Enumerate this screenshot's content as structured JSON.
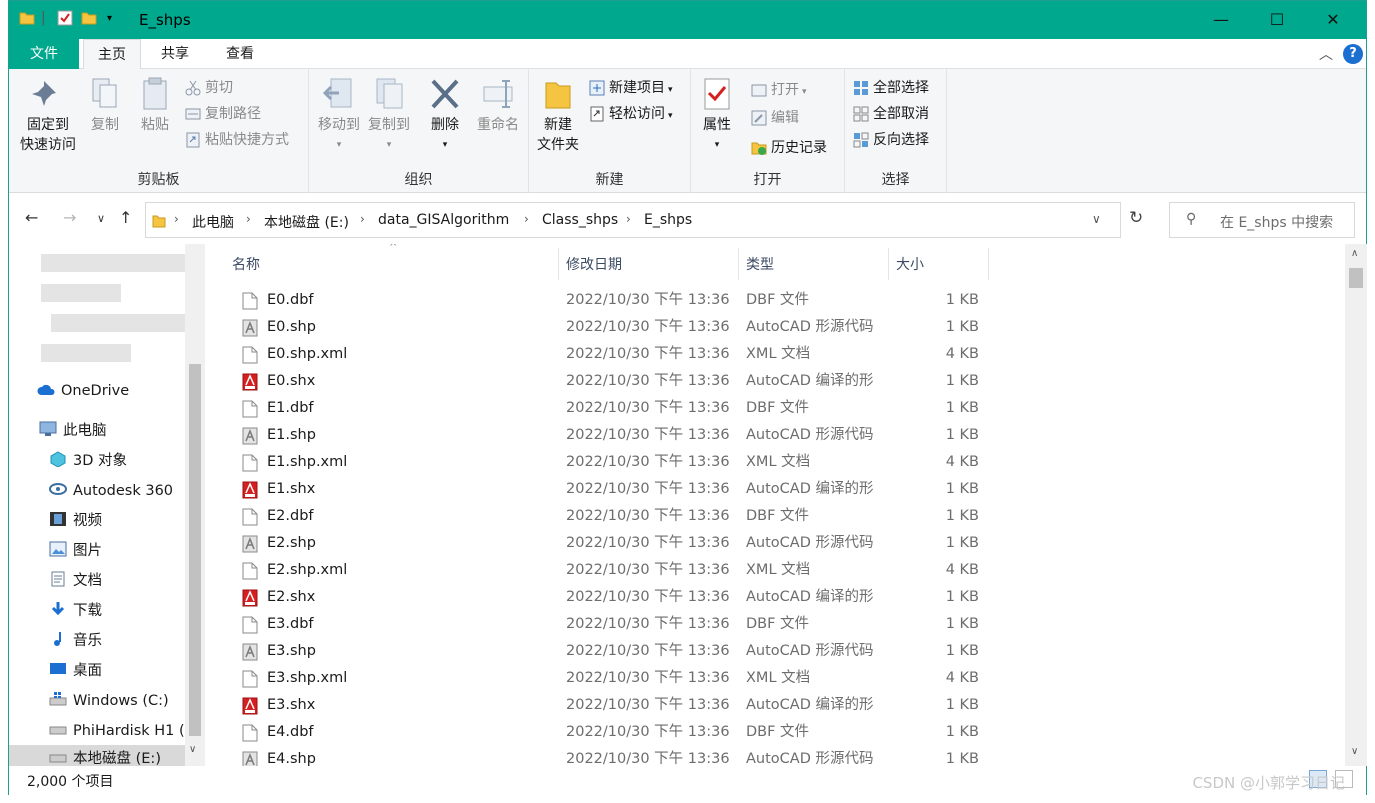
{
  "titlebar": {
    "title": "E_shps",
    "minimize": "—",
    "maximize": "☐",
    "close": "✕"
  },
  "ribbon_tabs": {
    "file": "文件",
    "home": "主页",
    "share": "共享",
    "view": "查看"
  },
  "clipboard": {
    "group_label": "剪贴板",
    "pin_line1": "固定到",
    "pin_line2": "快速访问",
    "copy": "复制",
    "paste": "粘贴",
    "cut": "剪切",
    "copy_path": "复制路径",
    "paste_shortcut": "粘贴快捷方式"
  },
  "organize": {
    "group_label": "组织",
    "move_to": "移动到",
    "copy_to": "复制到",
    "delete": "删除",
    "rename": "重命名"
  },
  "new": {
    "group_label": "新建",
    "new_folder_line1": "新建",
    "new_folder_line2": "文件夹",
    "new_item": "新建项目",
    "easy_access": "轻松访问"
  },
  "open": {
    "group_label": "打开",
    "properties": "属性",
    "open": "打开",
    "edit": "编辑",
    "history": "历史记录"
  },
  "select": {
    "group_label": "选择",
    "select_all": "全部选择",
    "select_none": "全部取消",
    "invert": "反向选择"
  },
  "breadcrumb": [
    "此电脑",
    "本地磁盘 (E:)",
    "data_GISAlgorithm",
    "Class_shps",
    "E_shps"
  ],
  "search": {
    "placeholder": "在 E_shps 中搜索"
  },
  "nav": {
    "onedrive": "OneDrive",
    "this_pc": "此电脑",
    "items": [
      "3D 对象",
      "Autodesk 360",
      "视频",
      "图片",
      "文档",
      "下载",
      "音乐",
      "桌面",
      "Windows (C:)",
      "PhiHardisk H1 (",
      "本地磁盘 (E:)"
    ]
  },
  "columns": {
    "name": "名称",
    "date": "修改日期",
    "type": "类型",
    "size": "大小"
  },
  "files": [
    {
      "name": "E0.dbf",
      "date": "2022/10/30 下午 13:36",
      "type": "DBF 文件",
      "size": "1 KB",
      "icon": "doc"
    },
    {
      "name": "E0.shp",
      "date": "2022/10/30 下午 13:36",
      "type": "AutoCAD 形源代码",
      "size": "1 KB",
      "icon": "shp"
    },
    {
      "name": "E0.shp.xml",
      "date": "2022/10/30 下午 13:36",
      "type": "XML 文档",
      "size": "4 KB",
      "icon": "doc"
    },
    {
      "name": "E0.shx",
      "date": "2022/10/30 下午 13:36",
      "type": "AutoCAD 编译的形",
      "size": "1 KB",
      "icon": "shx"
    },
    {
      "name": "E1.dbf",
      "date": "2022/10/30 下午 13:36",
      "type": "DBF 文件",
      "size": "1 KB",
      "icon": "doc"
    },
    {
      "name": "E1.shp",
      "date": "2022/10/30 下午 13:36",
      "type": "AutoCAD 形源代码",
      "size": "1 KB",
      "icon": "shp"
    },
    {
      "name": "E1.shp.xml",
      "date": "2022/10/30 下午 13:36",
      "type": "XML 文档",
      "size": "4 KB",
      "icon": "doc"
    },
    {
      "name": "E1.shx",
      "date": "2022/10/30 下午 13:36",
      "type": "AutoCAD 编译的形",
      "size": "1 KB",
      "icon": "shx"
    },
    {
      "name": "E2.dbf",
      "date": "2022/10/30 下午 13:36",
      "type": "DBF 文件",
      "size": "1 KB",
      "icon": "doc"
    },
    {
      "name": "E2.shp",
      "date": "2022/10/30 下午 13:36",
      "type": "AutoCAD 形源代码",
      "size": "1 KB",
      "icon": "shp"
    },
    {
      "name": "E2.shp.xml",
      "date": "2022/10/30 下午 13:36",
      "type": "XML 文档",
      "size": "4 KB",
      "icon": "doc"
    },
    {
      "name": "E2.shx",
      "date": "2022/10/30 下午 13:36",
      "type": "AutoCAD 编译的形",
      "size": "1 KB",
      "icon": "shx"
    },
    {
      "name": "E3.dbf",
      "date": "2022/10/30 下午 13:36",
      "type": "DBF 文件",
      "size": "1 KB",
      "icon": "doc"
    },
    {
      "name": "E3.shp",
      "date": "2022/10/30 下午 13:36",
      "type": "AutoCAD 形源代码",
      "size": "1 KB",
      "icon": "shp"
    },
    {
      "name": "E3.shp.xml",
      "date": "2022/10/30 下午 13:36",
      "type": "XML 文档",
      "size": "4 KB",
      "icon": "doc"
    },
    {
      "name": "E3.shx",
      "date": "2022/10/30 下午 13:36",
      "type": "AutoCAD 编译的形",
      "size": "1 KB",
      "icon": "shx"
    },
    {
      "name": "E4.dbf",
      "date": "2022/10/30 下午 13:36",
      "type": "DBF 文件",
      "size": "1 KB",
      "icon": "doc"
    },
    {
      "name": "E4.shp",
      "date": "2022/10/30 下午 13:36",
      "type": "AutoCAD 形源代码",
      "size": "1 KB",
      "icon": "shp"
    }
  ],
  "status": {
    "count": "2,000 个项目"
  },
  "watermark": "CSDN @小郭学习日记",
  "colors": {
    "accent": "#00a88e",
    "shx_red": "#d42020",
    "folder": "#f5c542"
  }
}
